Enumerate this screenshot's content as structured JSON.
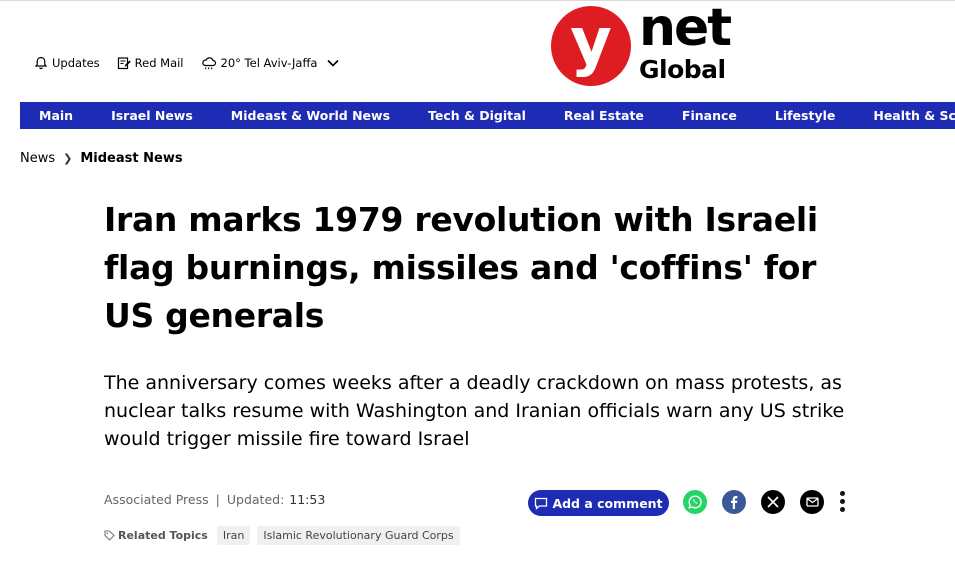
{
  "header": {
    "utilities": [
      {
        "icon": "bell-icon",
        "label": "Updates"
      },
      {
        "icon": "edit-note-icon",
        "label": "Red Mail"
      },
      {
        "icon": "weather-cloud-icon",
        "label": "20° Tel Aviv-Jaffa"
      }
    ],
    "logo": {
      "mark": "y",
      "net": "net",
      "global": "Global",
      "color": "#de1d23"
    }
  },
  "nav": {
    "color": "#1e2bb4",
    "items": [
      "Main",
      "Israel News",
      "Mideast & World News",
      "Tech & Digital",
      "Real Estate",
      "Finance",
      "Lifestyle",
      "Health & Science"
    ]
  },
  "breadcrumb": {
    "items": [
      "News",
      "Mideast News"
    ]
  },
  "article": {
    "title": "Iran marks 1979 revolution with Israeli flag burnings, missiles and 'coffins' for US generals",
    "subtitle": "The anniversary comes weeks after a deadly crackdown on mass protests, as nuclear talks resume with Washington and Iranian officials warn any US strike would trigger missile fire toward Israel",
    "source": "Associated Press",
    "separator": "|",
    "updated_label": "Updated:",
    "updated_time": "11:53"
  },
  "actions": {
    "comment_label": "Add a comment",
    "share": [
      {
        "name": "whatsapp-icon",
        "color": "#25d366"
      },
      {
        "name": "facebook-icon",
        "color": "#3b5998"
      },
      {
        "name": "x-icon",
        "color": "#000000"
      },
      {
        "name": "email-icon",
        "color": "#000000"
      }
    ]
  },
  "topics": {
    "label": "Related Topics",
    "tags": [
      "Iran",
      "Islamic Revolutionary Guard Corps"
    ]
  }
}
